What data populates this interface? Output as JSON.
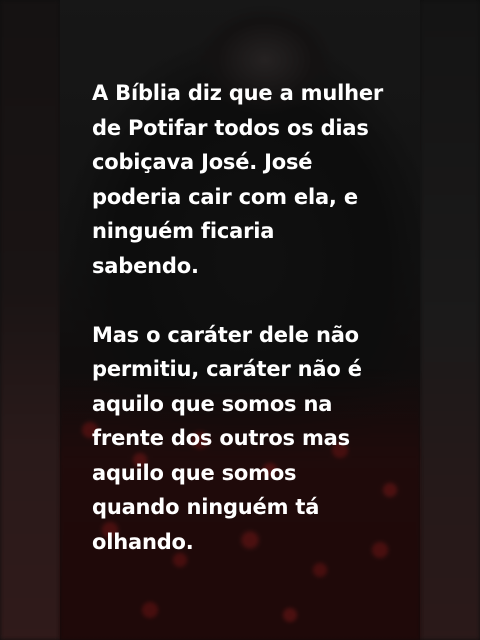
{
  "story": {
    "paragraphs": [
      "A Bíblia diz que a mulher\nde Potifar todos os dias\ncobiçava José. José\npoderia cair com ela, e\nninguém ficaria\nsabendo.",
      "Mas o caráter dele não\npermitiu, caráter não é\naquilo que somos na\nfrente dos outros mas\naquilo que somos\nquando ninguém tá\nolhando."
    ]
  },
  "colors": {
    "text": "#ffffff",
    "background": "#0e0e0e",
    "accent_red": "#b41e1e"
  }
}
